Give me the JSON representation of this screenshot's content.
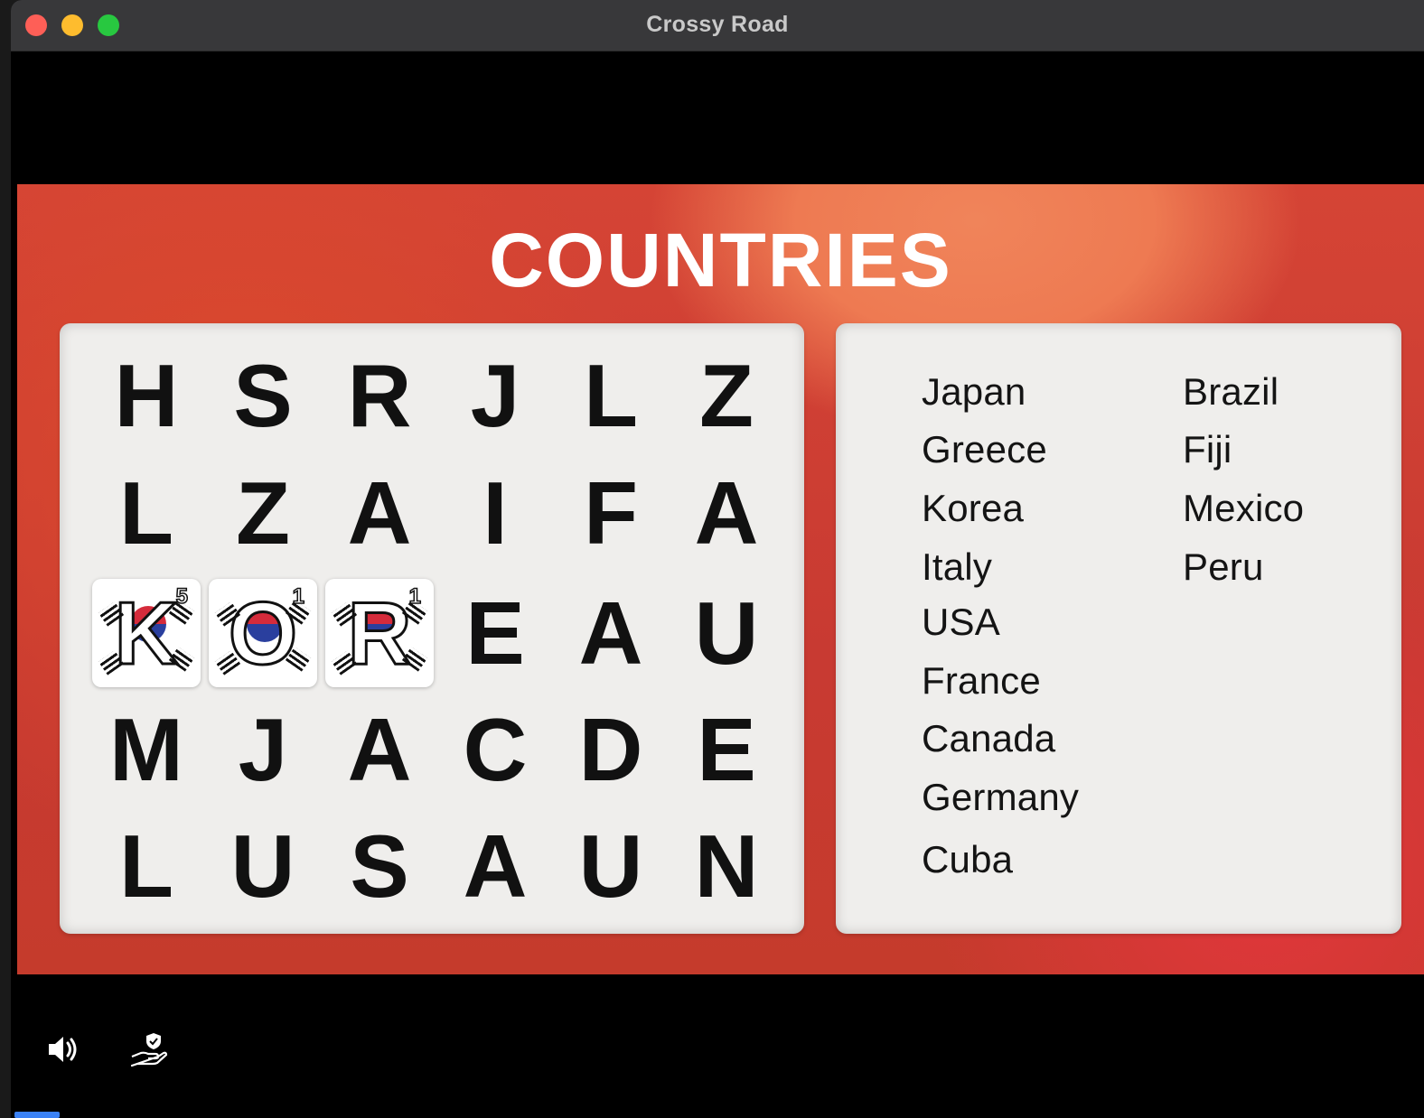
{
  "window": {
    "title": "Crossy Road"
  },
  "game": {
    "title": "COUNTRIES",
    "grid": [
      [
        "H",
        "S",
        "R",
        "J",
        "L",
        "Z"
      ],
      [
        "L",
        "Z",
        "A",
        "I",
        "F",
        "A"
      ],
      [
        "K",
        "O",
        "R",
        "E",
        "A",
        "U"
      ],
      [
        "M",
        "J",
        "A",
        "C",
        "D",
        "E"
      ],
      [
        "L",
        "U",
        "S",
        "A",
        "U",
        "N"
      ]
    ],
    "found_cells": [
      {
        "row": 2,
        "col": 0,
        "count": "5"
      },
      {
        "row": 2,
        "col": 1,
        "count": "1"
      },
      {
        "row": 2,
        "col": 2,
        "count": "1"
      }
    ],
    "words_left": [
      "Japan",
      "Greece",
      "Korea",
      "Italy",
      "USA",
      "France",
      "Canada",
      "Germany",
      "Cuba"
    ],
    "words_right": [
      "Brazil",
      "Fiji",
      "Mexico",
      "Peru"
    ]
  },
  "controls": {
    "volume_icon": "speaker-icon",
    "parental_icon": "hand-shield-icon",
    "progress_color": "#3b82f6"
  }
}
